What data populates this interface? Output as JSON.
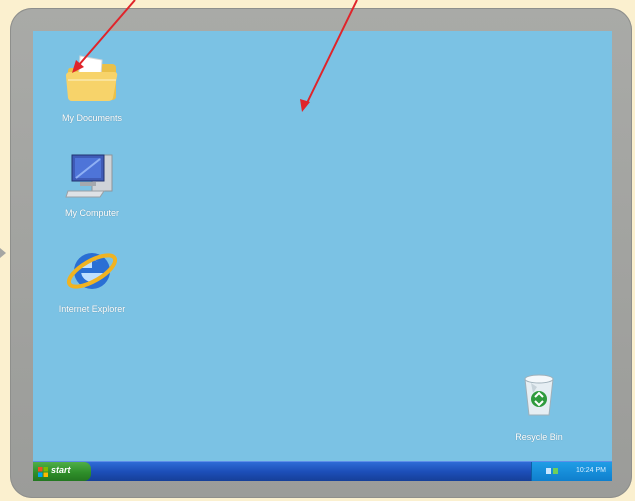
{
  "desktop": {
    "icons": [
      {
        "label": "My Documents",
        "icon": "folder-icon"
      },
      {
        "label": "My Computer",
        "icon": "computer-icon"
      },
      {
        "label": "Internet Explorer",
        "icon": "ie-icon"
      },
      {
        "label": "Resycle Bin",
        "icon": "recycle-bin-icon"
      }
    ]
  },
  "taskbar": {
    "start_label": "start",
    "clock": "10:24 PM"
  },
  "colors": {
    "desktop": "#7bc2e4",
    "frame": "#a9aaa7",
    "page": "#fbf0cf",
    "taskbar": "#1d4fb9",
    "start": "#2f8f2a",
    "arrow": "#e0242a"
  }
}
